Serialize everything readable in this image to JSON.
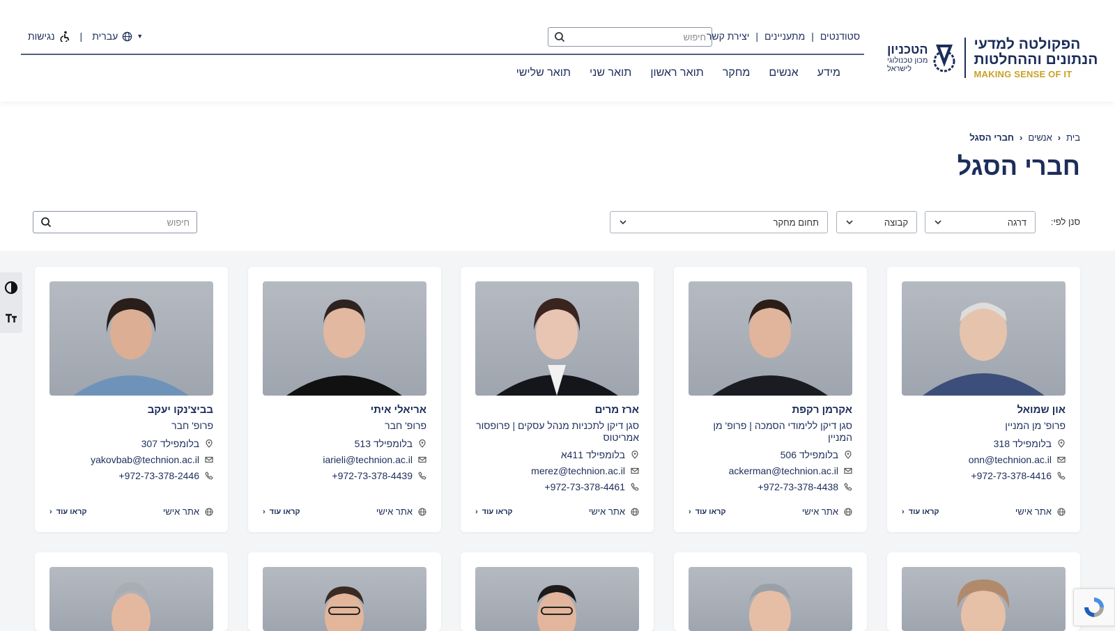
{
  "logo": {
    "faculty_line1": "הפקולטה למדעי",
    "faculty_line2": "הנתונים וההחלטות",
    "tagline": "MAKING SENSE OF IT",
    "technion_name": "הטכניון",
    "technion_sub1": "מכון טכנולוגי",
    "technion_sub2": "לישראל"
  },
  "top_links": [
    "סטודנטים",
    "מתעניינים",
    "יצירת קשר"
  ],
  "header_search": {
    "placeholder": "חיפוש"
  },
  "language": "עברית",
  "accessibility": "נגישות",
  "nav": [
    "מידע",
    "אנשים",
    "מחקר",
    "תואר ראשון",
    "תואר שני",
    "תואר שלישי"
  ],
  "breadcrumb": [
    "בית",
    "אנשים",
    "חברי הסגל"
  ],
  "page_title": "חברי הסגל",
  "filters": {
    "label": "סנן לפי:",
    "rank": "דרגה",
    "group": "קבוצה",
    "field": "תחום מחקר",
    "search_placeholder": "חיפוש"
  },
  "card_labels": {
    "website": "אתר אישי",
    "read_more": "קראו עוד"
  },
  "faculty": [
    {
      "name": "און שמואל",
      "title": "פרופ' מן המניין",
      "office": "בלומפילד 318",
      "email": "onn@technion.ac.il",
      "phone": "+972-73-378-4416"
    },
    {
      "name": "אקרמן רקפת",
      "title": "סגן דיקן ללימודי הסמכה | פרופ' מן המניין",
      "office": "בלומפילד 506",
      "email": "ackerman@technion.ac.il",
      "phone": "+972-73-378-4438"
    },
    {
      "name": "ארז מרים",
      "title": "סגן דיקן לתכניות מנהל עסקים | פרופסור אמריטוס",
      "office": "בלומפילד 411א",
      "email": "merez@technion.ac.il",
      "phone": "+972-73-378-4461"
    },
    {
      "name": "אריאלי איתי",
      "title": "פרופ' חבר",
      "office": "בלומפילד 513",
      "email": "iarieli@technion.ac.il",
      "phone": "+972-73-378-4439"
    },
    {
      "name": "בביצ'נקו יעקב",
      "title": "פרופ' חבר",
      "office": "בלומפילד 307",
      "email": "yakovbab@technion.ac.il",
      "phone": "+972-73-378-2446"
    }
  ],
  "colors": {
    "brand_navy": "#1c2d5a",
    "brand_gold": "#c9a227",
    "content_bg": "#f4f5f7"
  }
}
